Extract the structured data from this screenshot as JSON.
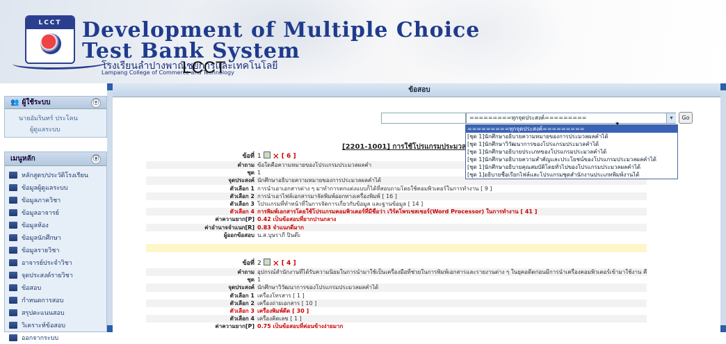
{
  "banner": {
    "logo_text": "LCCT",
    "title_line1": "Development of Multiple Choice",
    "title_line2": "Test Bank System",
    "school_th": "โรงเรียนลำปางพาณิชยการและเทคโนโลยี",
    "school_en": "Lampang College of Commerce and Technology",
    "school_abbr": "LCCT"
  },
  "sidebar": {
    "user_title": "ผู้ใช้ระบบ",
    "user_name": "นายอัมรินทร์ ประโคน",
    "logout": "ผู้ดูแลระบบ",
    "menu_title": "เมนูหลัก",
    "items": [
      {
        "label": "หลักสูตร/ประวัติโรงเรียน"
      },
      {
        "label": "ข้อมูลผู้ดูแลระบบ"
      },
      {
        "label": "ข้อมูลภาควิชา"
      },
      {
        "label": "ข้อมูลอาจารย์"
      },
      {
        "label": "ข้อมูลห้อง"
      },
      {
        "label": "ข้อมูลนักศึกษา"
      },
      {
        "label": "ข้อมูลรายวิชา"
      },
      {
        "label": "อาจารย์ประจำวิชา"
      },
      {
        "label": "จุดประสงค์รายวิชา"
      },
      {
        "label": "ข้อสอบ"
      },
      {
        "label": "กำหนดการสอบ"
      },
      {
        "label": "สรุปคะแนนสอบ"
      },
      {
        "label": "วิเคราะห์ข้อสอบ"
      },
      {
        "label": "ออกจากระบบ"
      }
    ]
  },
  "content": {
    "header": "ข้อสอบ",
    "select_value": "=========ทุกจุดประสงค์=========",
    "go_label": "Go",
    "course_title": "[2201-1001] การใช้โปรแกรมประมวลผลคำ",
    "dropdown_options": [
      "=========ทุกจุดประสงค์=========",
      "[ชุด 1]นักศึกษาอธิบายความหมายของการประมวลผลคำได้",
      "[ชุด 1]นักศึกษาวิวัฒนาการของโปรแกรมประมวลคำได้",
      "[ชุด 1]นักศึกษาอธิบายประเภทของโปรแกรมประมวลคำได้",
      "[ชุด 1]นักศึกษาอธิบายความสำคัญและประโยชน์ของโปรแกรมประมวลผลคำได้",
      "[ชุด 1]นักศึกษาอธิบายคุณสมบัติโดยทั่วไปของโปรแกรมประมวลผลคำได้",
      "[ชุด 1]อธิบายชื่อเรียกไฟล์และโปรแกรมชุดสำนักงานประเภทพิมพ์งานได้"
    ],
    "questions": [
      {
        "num_label": "ข้อที่",
        "num": "1",
        "count": "[ 6 ]",
        "rows": [
          {
            "label": "คำถาม",
            "value": "ข้อใดคือความหมายของโปรแกรมประมวลผลคำ"
          },
          {
            "label": "ชุด",
            "value": "1"
          },
          {
            "label": "จุดประสงค์",
            "value": "นักศึกษาอธิบายความหมายของการประมวลผลคำได้"
          },
          {
            "label": "ตัวเลือก 1",
            "value": "การนำเอาเอกสารต่าง ๆ มาทำการตกแต่งแบบก็ได้ที่สอบถามโดยใช้คอมพิวเตอร์ในการทำงาน [ 9 ]"
          },
          {
            "label": "ตัวเลือก 2",
            "value": "การนำเอาไฟล์เอกสารมาจัดพิมพ์ออกทางเครื่องพิมพ์ [ 16 ]"
          },
          {
            "label": "ตัวเลือก 3",
            "value": "โปรแกรมที่ทำหน้าที่ในการจัดการเกี่ยวกับข้อมูล และฐานข้อมูล [ 14 ]"
          },
          {
            "label": "ตัวเลือก 4",
            "value": "การพิมพ์เอกสารโดยใช้โปรแกรมคอมพิวเตอร์ที่มีชื่อว่า เวิร์ดโพรเซสเซอร์(Word Processor) ในการทำงาน [ 41 ]",
            "answer": true
          },
          {
            "label": "ค่าความยาก[P]",
            "value": "0.42  เป็นข้อสอบที่ยากปานกลาง",
            "red": true
          },
          {
            "label": "ค่าอำนาจจำแนก[R]",
            "value": "0.83  จำแนกดีมาก",
            "red": true
          },
          {
            "label": "ผู้ออกข้อสอบ",
            "value": "น.ส.บุษราภี ปินต๊ะ"
          }
        ]
      },
      {
        "num_label": "ข้อที่",
        "num": "2",
        "count": "[ 4 ]",
        "rows": [
          {
            "label": "คำถาม",
            "value": "อุปกรณ์สำนักงานที่ได้รับความนิยมในการนำมาใช้เป็นเครื่องมือที่ช่วยในการพิมพ์เอกสารและรายงานต่าง ๆ ในยุคอดีตก่อนมีการนำเครื่องคอมพิวเตอร์เข้ามาใช้งาน คือ"
          },
          {
            "label": "ชุด",
            "value": "1"
          },
          {
            "label": "จุดประสงค์",
            "value": "นักศึกษาวิวัฒนาการของโปรแกรมประมวลผลคำได้"
          },
          {
            "label": "ตัวเลือก 1",
            "value": "เครื่องโทรสาร  [ 1 ]"
          },
          {
            "label": "ตัวเลือก 2",
            "value": "เครื่องถ่ายเอกสาร  [ 10 ]"
          },
          {
            "label": "ตัวเลือก 3",
            "value": "เครื่องพิมพ์ดีด  [ 30 ]",
            "answer": true
          },
          {
            "label": "ตัวเลือก 4",
            "value": "เครื่องคิดเลข  [ 1 ]"
          },
          {
            "label": "ค่าความยาก[P]",
            "value": "0.75  เป็นข้อสอบที่ค่อนข้างง่ายมาก",
            "red": true
          }
        ]
      }
    ]
  }
}
